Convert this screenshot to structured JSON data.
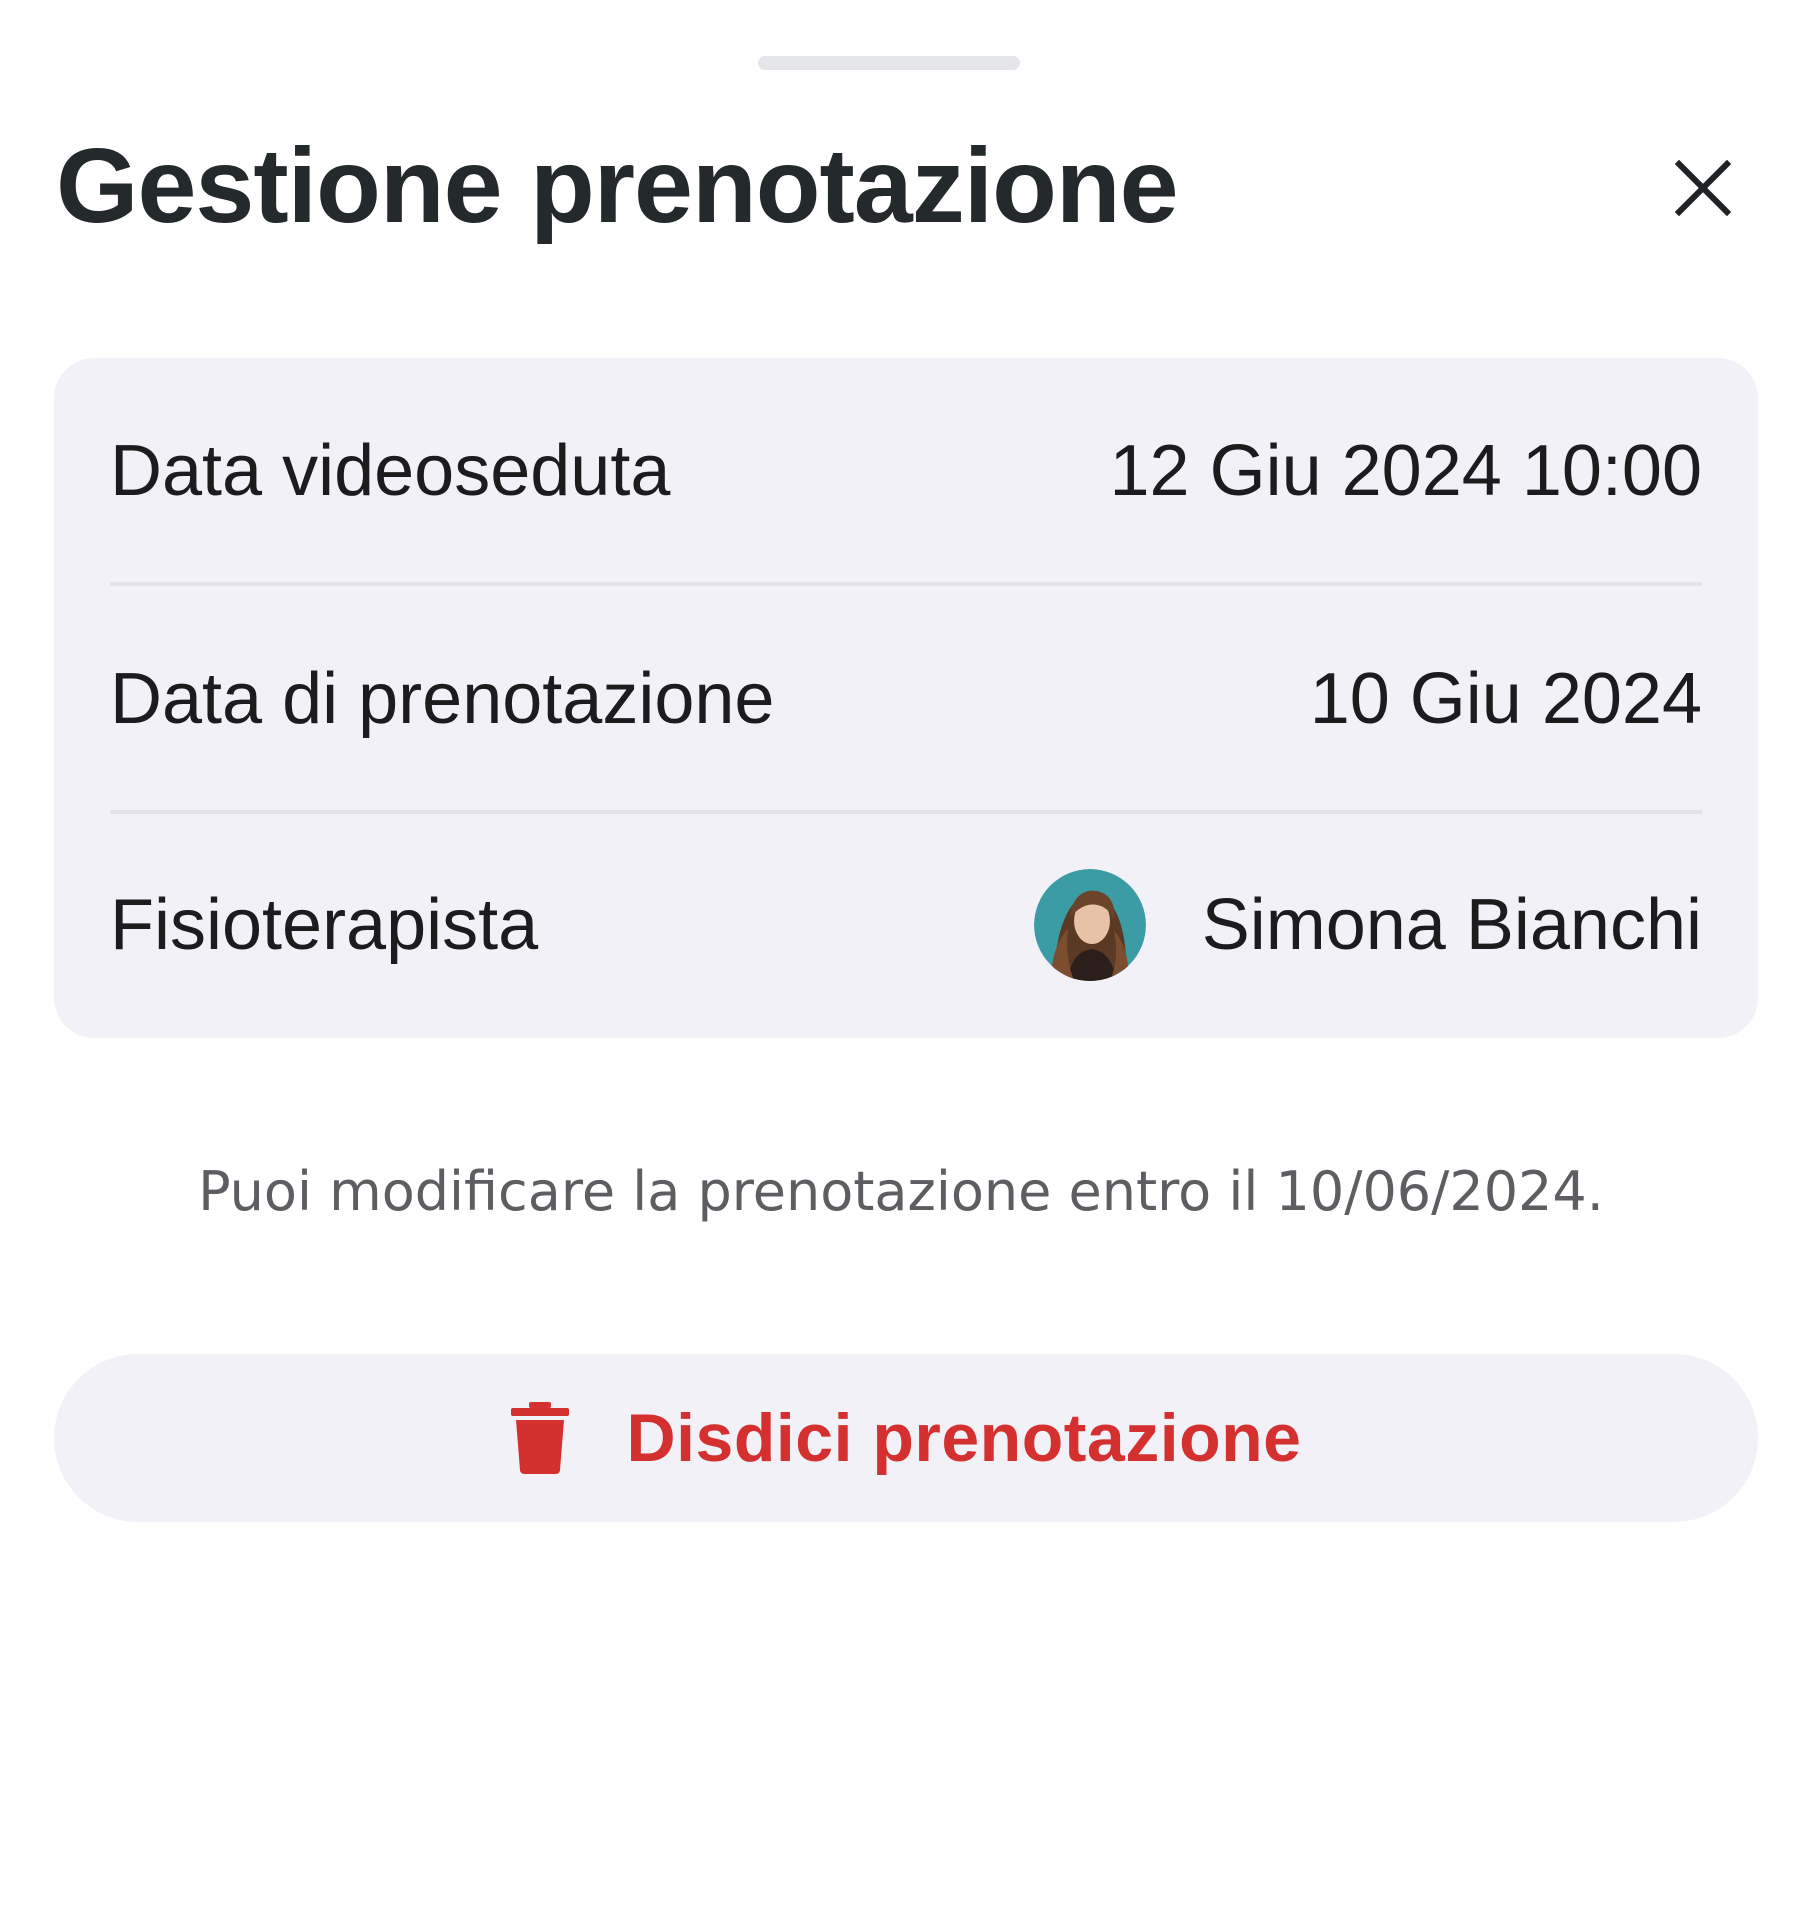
{
  "sheet": {
    "title": "Gestione prenotazione",
    "close_icon": "close-icon"
  },
  "details": {
    "rows": [
      {
        "label": "Data videoseduta",
        "value": "12 Giu 2024 10:00"
      },
      {
        "label": "Data di prenotazione",
        "value": "10 Giu 2024"
      },
      {
        "label": "Fisioterapista",
        "value": "Simona Bianchi",
        "avatar": "avatar-photo"
      }
    ]
  },
  "note": "Puoi modificare la prenotazione entro il 10/06/2024.",
  "actions": {
    "cancel_label": "Disdici prenotazione",
    "cancel_icon": "trash-icon"
  },
  "colors": {
    "title": "#24292b",
    "card_background": "#f2f1f7",
    "destructive": "#d3302f",
    "note_text": "#5d5d62"
  }
}
